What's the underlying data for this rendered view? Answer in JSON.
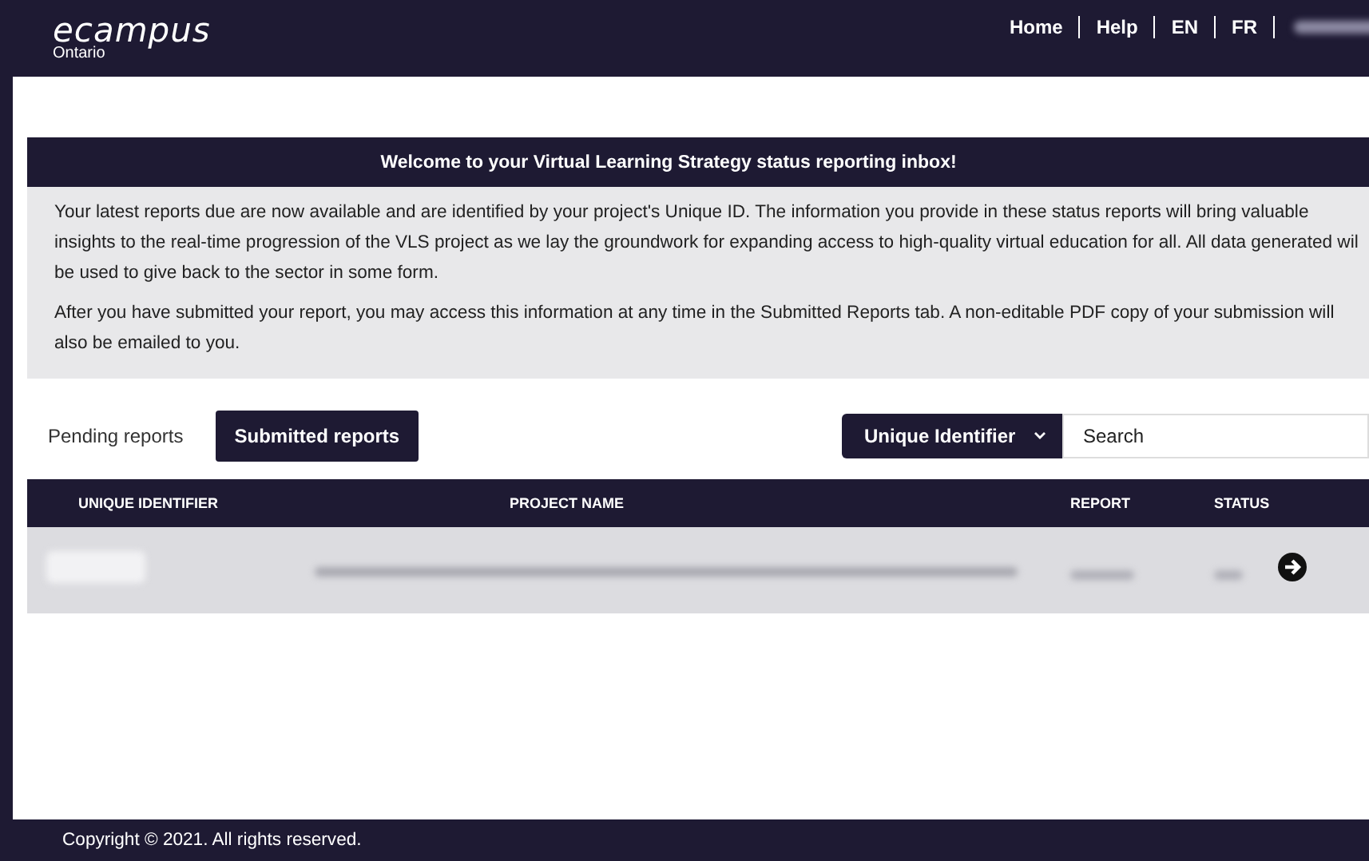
{
  "header": {
    "logo": {
      "wordmark": "ecampus",
      "sub": "Ontario"
    },
    "nav": [
      "Home",
      "Help",
      "EN",
      "FR"
    ]
  },
  "welcome": {
    "title": "Welcome to your Virtual Learning Strategy status reporting inbox!",
    "paragraphs": [
      [
        "Your latest reports due are now available and are identified by your project's Unique ID. The information you provide in these status reports will bring valuable",
        "insights to the real-time progression of the VLS project as we lay the groundwork for expanding access to high-quality virtual education for all. All data generated wil",
        "be used to give back to the sector in some form."
      ],
      [
        "After you have submitted your report, you may access this information at any time in the Submitted Reports tab. A non-editable PDF copy of your submission will",
        "also be emailed to you."
      ]
    ]
  },
  "tabs": [
    {
      "label": "Pending reports",
      "selected": false
    },
    {
      "label": "Submitted reports",
      "selected": true
    }
  ],
  "filter": {
    "value": "Unique Identifier"
  },
  "search": {
    "placeholder": "Search"
  },
  "table": {
    "columns": [
      "UNIQUE IDENTIFIER",
      "PROJECT NAME",
      "REPORT",
      "STATUS"
    ]
  },
  "footer": {
    "copyright": "Copyright © 2021. All rights reserved."
  }
}
